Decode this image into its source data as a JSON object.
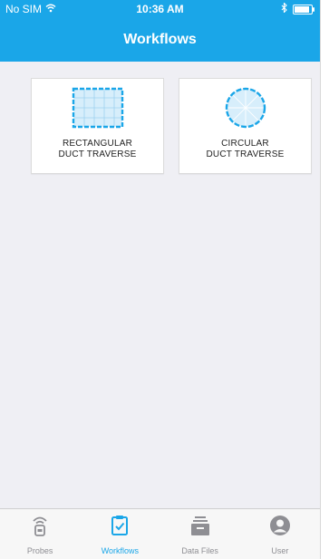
{
  "status": {
    "carrier": "No SIM",
    "time": "10:36 AM",
    "battery_level": 0.9
  },
  "nav": {
    "title": "Workflows"
  },
  "workflows": [
    {
      "label": "RECTANGULAR\nDUCT TRAVERSE",
      "icon": "rectangular-duct-icon"
    },
    {
      "label": "CIRCULAR\nDUCT TRAVERSE",
      "icon": "circular-duct-icon"
    }
  ],
  "tabs": [
    {
      "label": "Probes",
      "icon": "probe-icon",
      "active": false
    },
    {
      "label": "Workflows",
      "icon": "clipboard-check-icon",
      "active": true
    },
    {
      "label": "Data Files",
      "icon": "data-files-icon",
      "active": false
    },
    {
      "label": "User",
      "icon": "user-icon",
      "active": false
    }
  ],
  "colors": {
    "accent": "#1aa6e8",
    "inactive": "#8e8e93",
    "background": "#efeff4"
  }
}
